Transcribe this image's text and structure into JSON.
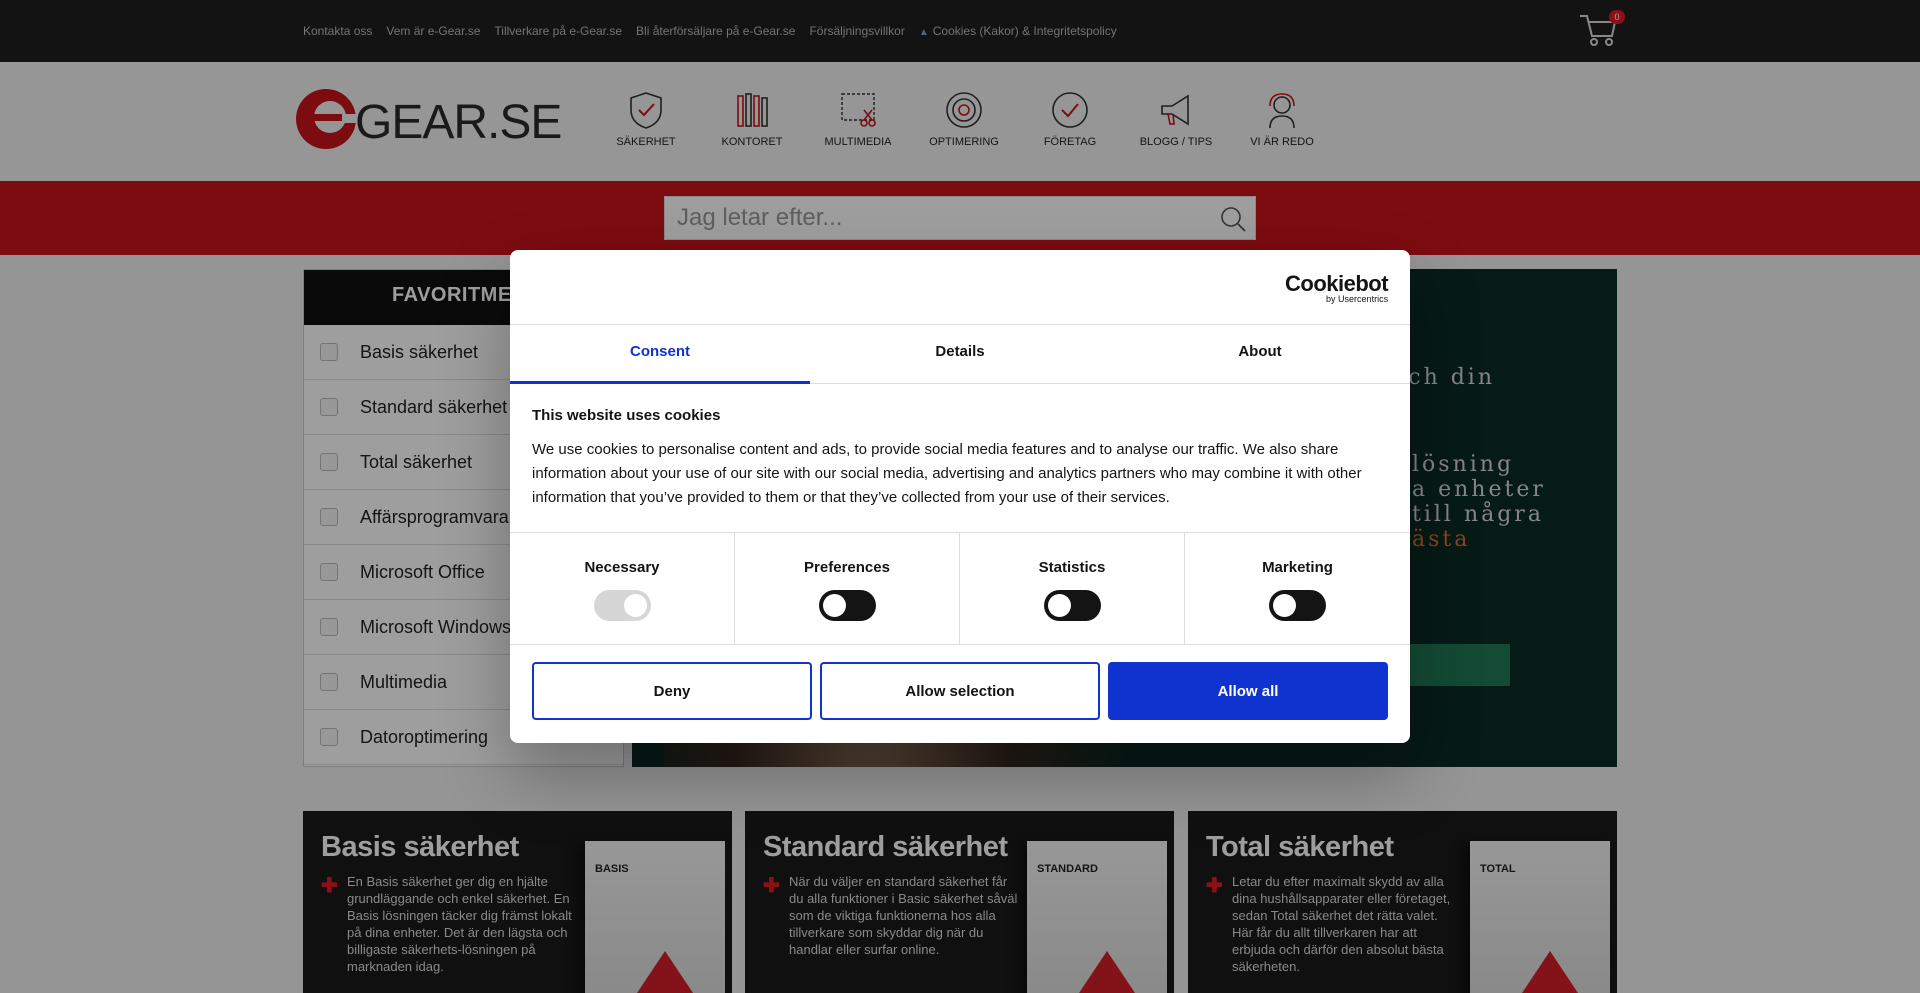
{
  "topbar": {
    "links": [
      "Kontakta oss",
      "Vem är e-Gear.se",
      "Tillverkare på e-Gear.se",
      "Bli återförsäljare på e-Gear.se",
      "Försäljningsvillkor",
      "Cookies (Kakor) & Integritetspolicy"
    ],
    "cart_count": "0"
  },
  "logo": {
    "text": "GEAR.SE"
  },
  "nav": [
    "SÄKERHET",
    "KONTORET",
    "MULTIMEDIA",
    "OPTIMERING",
    "FÖRETAG",
    "BLOGG / TIPS",
    "VI ÄR REDO"
  ],
  "search": {
    "placeholder": "Jag letar efter..."
  },
  "sidemenu": {
    "title": "FAVORITME",
    "items": [
      "Basis säkerhet",
      "Standard säkerhet",
      "Total säkerhet",
      "Affärsprogramvara",
      "Microsoft Office",
      "Microsoft Windows",
      "Multimedia",
      "Datoroptimering"
    ]
  },
  "banner": {
    "line1": "och din",
    "line2": "lösning",
    "line3": "a enheter",
    "line4": "till några",
    "line5": "ästa"
  },
  "cards": [
    {
      "title": "Basis säkerhet",
      "text": "En Basis säkerhet ger dig en hjälte grundläggande och enkel säkerhet. En Basis lösningen täcker dig främst lokalt på dina enheter. Det är den lägsta och billigaste säkerhets-lösningen på marknaden idag.",
      "box": "BASIS"
    },
    {
      "title": "Standard säkerhet",
      "text": "När du väljer en standard säkerhet får du alla funktioner i Basic säkerhet såväl som de viktiga funktionerna hos alla tillverkare som skyddar dig när du handlar eller surfar online.",
      "box": "STANDARD"
    },
    {
      "title": "Total säkerhet",
      "text": "Letar du efter maximalt skydd av alla dina hushållsapparater eller företaget, sedan Total säkerhet det rätta valet. Här får du allt tillverkaren har att erbjuda och därför den absolut bästa säkerheten.",
      "box": "TOTAL"
    }
  ],
  "cookie": {
    "brand": "Cookiebot",
    "brand_sub": "by Usercentrics",
    "tabs": [
      "Consent",
      "Details",
      "About"
    ],
    "heading": "This website uses cookies",
    "body": "We use cookies to personalise content and ads, to provide social media features and to analyse our traffic. We also share information about your use of our site with our social media, advertising and analytics partners who may combine it with other information that you’ve provided to them or that they’ve collected from your use of their services.",
    "toggles": [
      "Necessary",
      "Preferences",
      "Statistics",
      "Marketing"
    ],
    "buttons": {
      "deny": "Deny",
      "allow_selection": "Allow selection",
      "allow_all": "Allow all"
    }
  },
  "colors": {
    "brand_red": "#c8141b",
    "cookie_blue": "#1032cf"
  }
}
